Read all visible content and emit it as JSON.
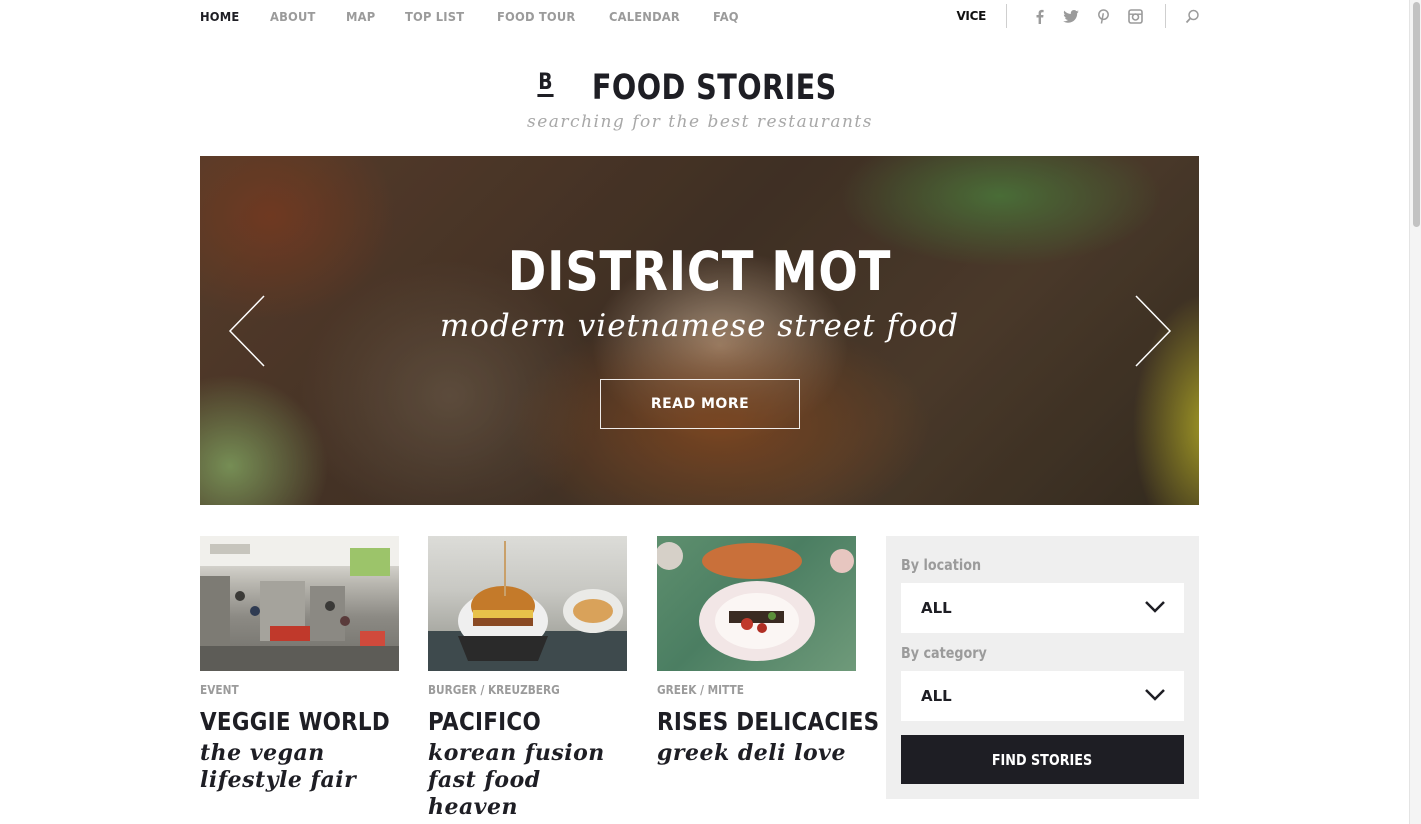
{
  "nav": {
    "links": [
      "HOME",
      "ABOUT",
      "MAP",
      "TOP LIST",
      "FOOD TOUR",
      "CALENDAR",
      "FAQ"
    ],
    "active": "HOME",
    "partner_logo": "VICE",
    "social_icons": [
      "facebook-icon",
      "twitter-icon",
      "pinterest-icon",
      "instagram-icon"
    ],
    "search_icon": "search-icon"
  },
  "brand": {
    "mark": "B",
    "name": "FOOD STORIES",
    "tagline": "searching for the best restaurants"
  },
  "hero": {
    "title": "DISTRICT MOT",
    "subtitle": "modern vietnamese street food",
    "button_label": "READ MORE",
    "prev_icon": "chevron-left-icon",
    "next_icon": "chevron-right-icon"
  },
  "cards": [
    {
      "category": "EVENT",
      "title": "VEGGIE WORLD",
      "subtitle_lines": [
        "the vegan",
        "lifestyle fair"
      ]
    },
    {
      "category": "BURGER / KREUZBERG",
      "title": "PACIFICO",
      "subtitle_lines": [
        "korean fusion",
        "fast food heaven"
      ]
    },
    {
      "category": "GREEK / MITTE",
      "title": "RISES DELICACIES",
      "subtitle_lines": [
        "greek deli love"
      ]
    }
  ],
  "filter": {
    "location_label": "By location",
    "location_value": "ALL",
    "category_label": "By category",
    "category_value": "ALL",
    "button_label": "FIND STORIES"
  },
  "colors": {
    "text_dark": "#1e1e24",
    "text_muted": "#9b9b9b",
    "panel_bg": "#efefef",
    "button_bg": "#1e1e24"
  }
}
